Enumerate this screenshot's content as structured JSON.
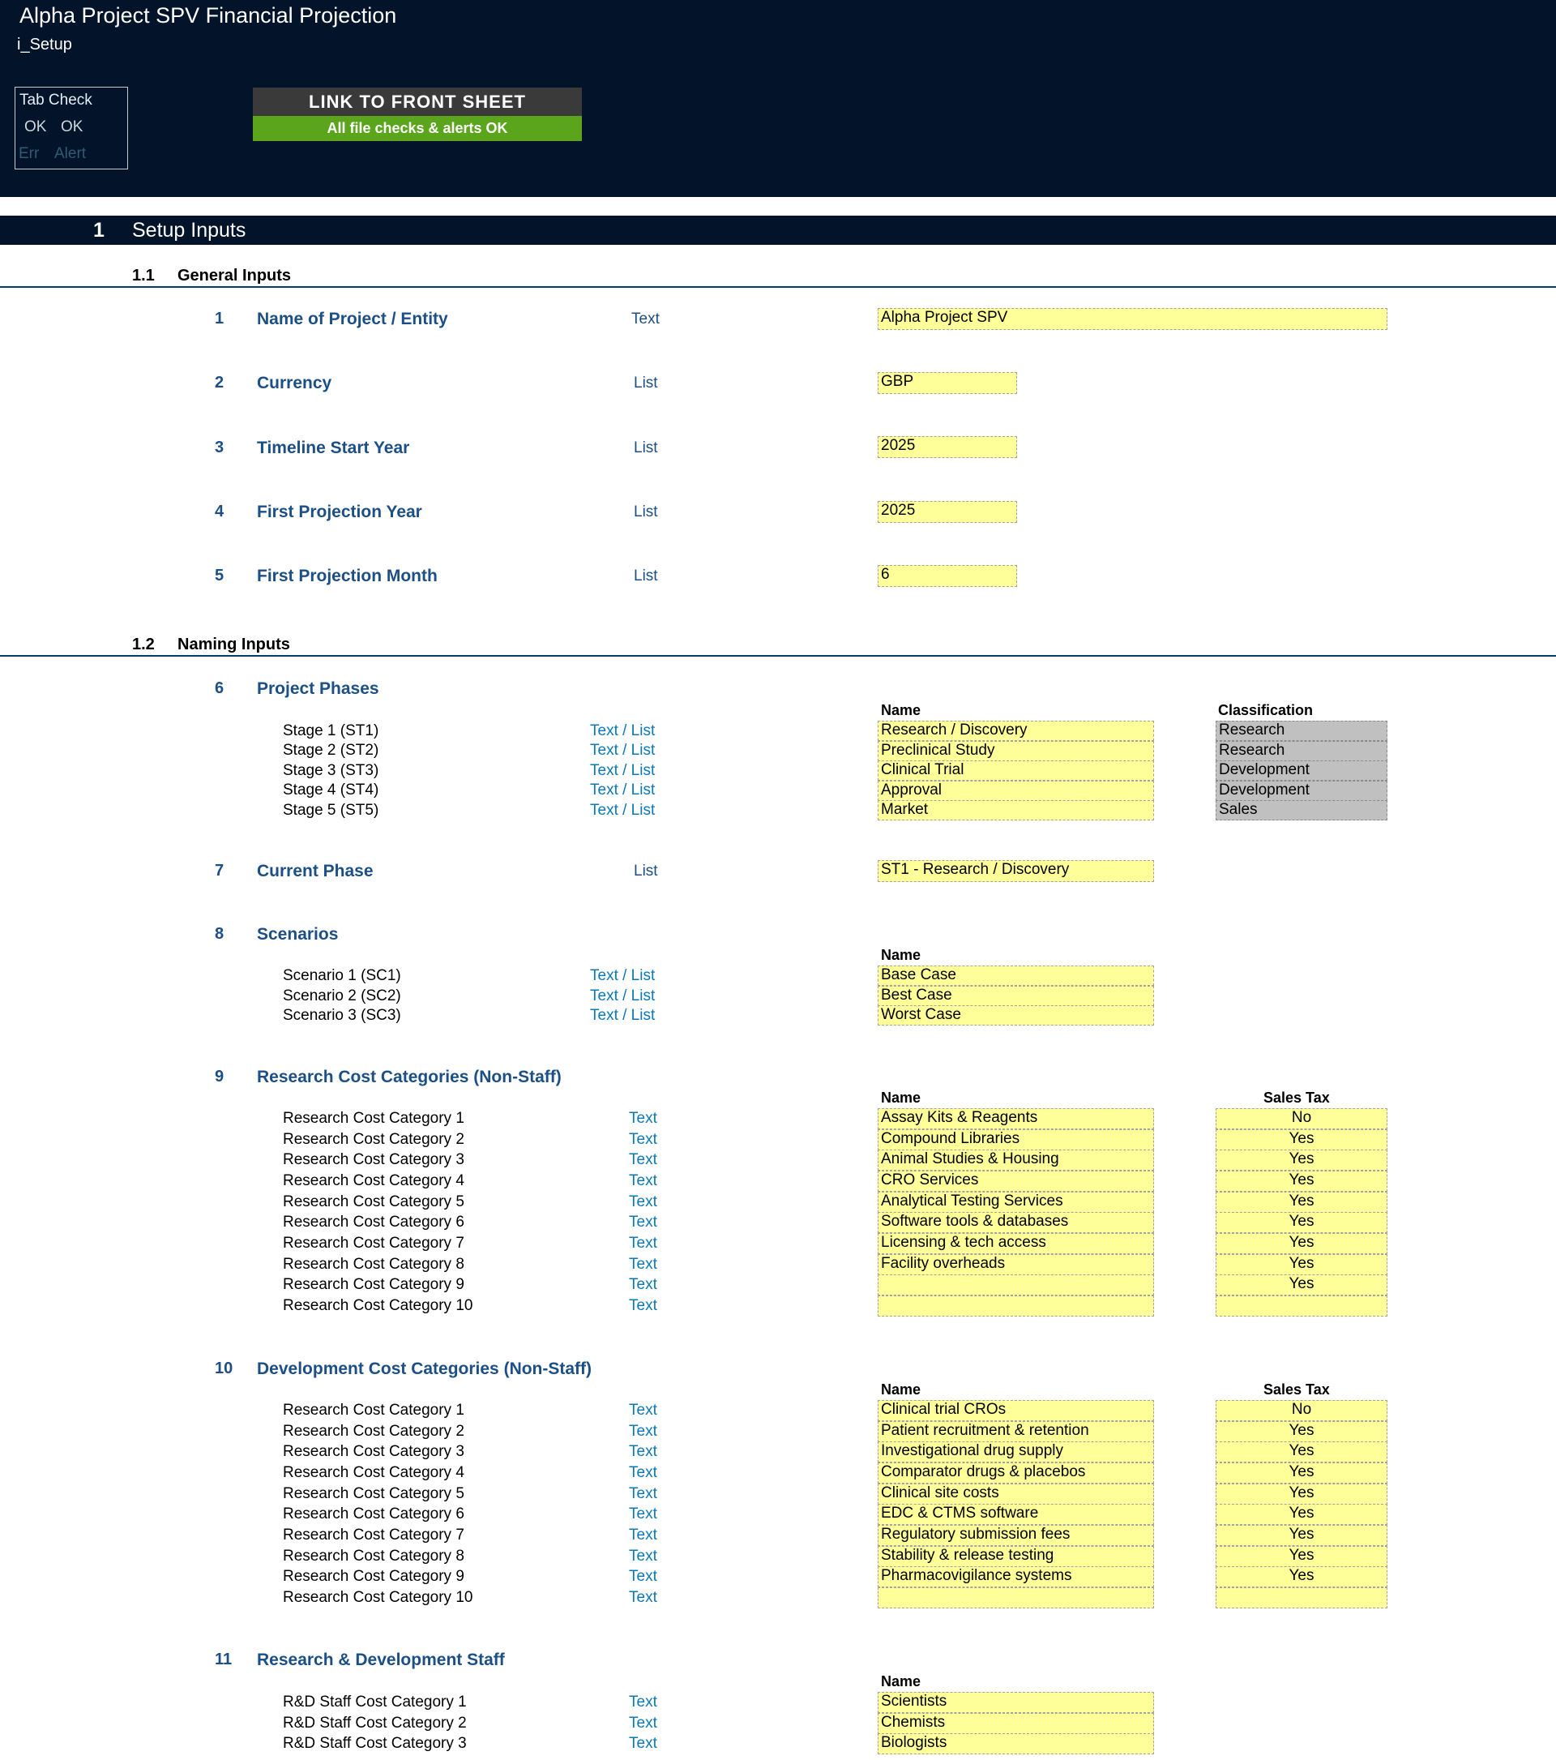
{
  "header": {
    "title": "Alpha Project SPV Financial Projection",
    "tab_name": "i_Setup",
    "tab_check": {
      "title": "Tab Check",
      "ok1": "OK",
      "ok2": "OK",
      "err": "Err",
      "alert": "Alert"
    },
    "link_button": "LINK TO FRONT SHEET",
    "checks_status": "All file checks & alerts OK",
    "checks_color": "#5aa51b"
  },
  "section1": {
    "num": "1",
    "title": "Setup Inputs"
  },
  "sub11": {
    "num": "1.1",
    "title": "General Inputs"
  },
  "general_inputs": [
    {
      "num": "1",
      "label": "Name of Project / Entity",
      "type": "Text",
      "value": "Alpha Project SPV"
    },
    {
      "num": "2",
      "label": "Currency",
      "type": "List",
      "value": "GBP"
    },
    {
      "num": "3",
      "label": "Timeline Start Year",
      "type": "List",
      "value": "2025"
    },
    {
      "num": "4",
      "label": "First Projection Year",
      "type": "List",
      "value": "2025"
    },
    {
      "num": "5",
      "label": "First Projection Month",
      "type": "List",
      "value": "6"
    }
  ],
  "sub12": {
    "num": "1.2",
    "title": "Naming Inputs"
  },
  "phases": {
    "num": "6",
    "label": "Project Phases",
    "name_header": "Name",
    "class_header": "Classification",
    "rows": [
      {
        "label": "Stage 1 (ST1)",
        "type": "Text / List",
        "name": "Research / Discovery",
        "class": "Research"
      },
      {
        "label": "Stage 2 (ST2)",
        "type": "Text / List",
        "name": "Preclinical Study",
        "class": "Research"
      },
      {
        "label": "Stage 3 (ST3)",
        "type": "Text / List",
        "name": "Clinical Trial",
        "class": "Development"
      },
      {
        "label": "Stage 4 (ST4)",
        "type": "Text / List",
        "name": "Approval",
        "class": "Development"
      },
      {
        "label": "Stage 5 (ST5)",
        "type": "Text / List",
        "name": "Market",
        "class": "Sales"
      }
    ]
  },
  "current_phase": {
    "num": "7",
    "label": "Current Phase",
    "type": "List",
    "value": "ST1 - Research / Discovery"
  },
  "scenarios": {
    "num": "8",
    "label": "Scenarios",
    "name_header": "Name",
    "rows": [
      {
        "label": "Scenario 1 (SC1)",
        "type": "Text / List",
        "name": "Base Case"
      },
      {
        "label": "Scenario 2 (SC2)",
        "type": "Text / List",
        "name": "Best Case"
      },
      {
        "label": "Scenario 3 (SC3)",
        "type": "Text / List",
        "name": "Worst Case"
      }
    ]
  },
  "research_costs": {
    "num": "9",
    "label": "Research Cost Categories (Non-Staff)",
    "name_header": "Name",
    "tax_header": "Sales Tax",
    "rows": [
      {
        "label": "Research Cost Category 1",
        "type": "Text",
        "name": "Assay Kits & Reagents",
        "tax": "No"
      },
      {
        "label": "Research Cost Category 2",
        "type": "Text",
        "name": "Compound Libraries",
        "tax": "Yes"
      },
      {
        "label": "Research Cost Category 3",
        "type": "Text",
        "name": "Animal Studies & Housing",
        "tax": "Yes"
      },
      {
        "label": "Research Cost Category 4",
        "type": "Text",
        "name": "CRO Services",
        "tax": "Yes"
      },
      {
        "label": "Research Cost Category 5",
        "type": "Text",
        "name": "Analytical Testing Services",
        "tax": "Yes"
      },
      {
        "label": "Research Cost Category 6",
        "type": "Text",
        "name": "Software tools & databases",
        "tax": "Yes"
      },
      {
        "label": "Research Cost Category 7",
        "type": "Text",
        "name": "Licensing & tech access",
        "tax": "Yes"
      },
      {
        "label": "Research Cost Category 8",
        "type": "Text",
        "name": "Facility overheads",
        "tax": "Yes"
      },
      {
        "label": "Research Cost Category 9",
        "type": "Text",
        "name": "",
        "tax": "Yes"
      },
      {
        "label": "Research Cost Category 10",
        "type": "Text",
        "name": "",
        "tax": ""
      }
    ]
  },
  "dev_costs": {
    "num": "10",
    "label": "Development Cost Categories (Non-Staff)",
    "name_header": "Name",
    "tax_header": "Sales Tax",
    "rows": [
      {
        "label": "Research Cost Category 1",
        "type": "Text",
        "name": "Clinical trial CROs",
        "tax": "No"
      },
      {
        "label": "Research Cost Category 2",
        "type": "Text",
        "name": "Patient recruitment & retention",
        "tax": "Yes"
      },
      {
        "label": "Research Cost Category 3",
        "type": "Text",
        "name": "Investigational drug supply",
        "tax": "Yes"
      },
      {
        "label": "Research Cost Category 4",
        "type": "Text",
        "name": "Comparator drugs & placebos",
        "tax": "Yes"
      },
      {
        "label": "Research Cost Category 5",
        "type": "Text",
        "name": "Clinical site costs",
        "tax": "Yes"
      },
      {
        "label": "Research Cost Category 6",
        "type": "Text",
        "name": "EDC & CTMS software",
        "tax": "Yes"
      },
      {
        "label": "Research Cost Category 7",
        "type": "Text",
        "name": "Regulatory submission fees",
        "tax": "Yes"
      },
      {
        "label": "Research Cost Category 8",
        "type": "Text",
        "name": "Stability & release testing",
        "tax": "Yes"
      },
      {
        "label": "Research Cost Category 9",
        "type": "Text",
        "name": "Pharmacovigilance systems",
        "tax": "Yes"
      },
      {
        "label": "Research Cost Category 10",
        "type": "Text",
        "name": "",
        "tax": ""
      }
    ]
  },
  "rd_staff": {
    "num": "11",
    "label": "Research & Development Staff",
    "name_header": "Name",
    "rows": [
      {
        "label": "R&D Staff Cost Category 1",
        "type": "Text",
        "name": "Scientists"
      },
      {
        "label": "R&D Staff Cost Category 2",
        "type": "Text",
        "name": "Chemists"
      },
      {
        "label": "R&D Staff Cost Category 3",
        "type": "Text",
        "name": "Biologists"
      }
    ]
  }
}
